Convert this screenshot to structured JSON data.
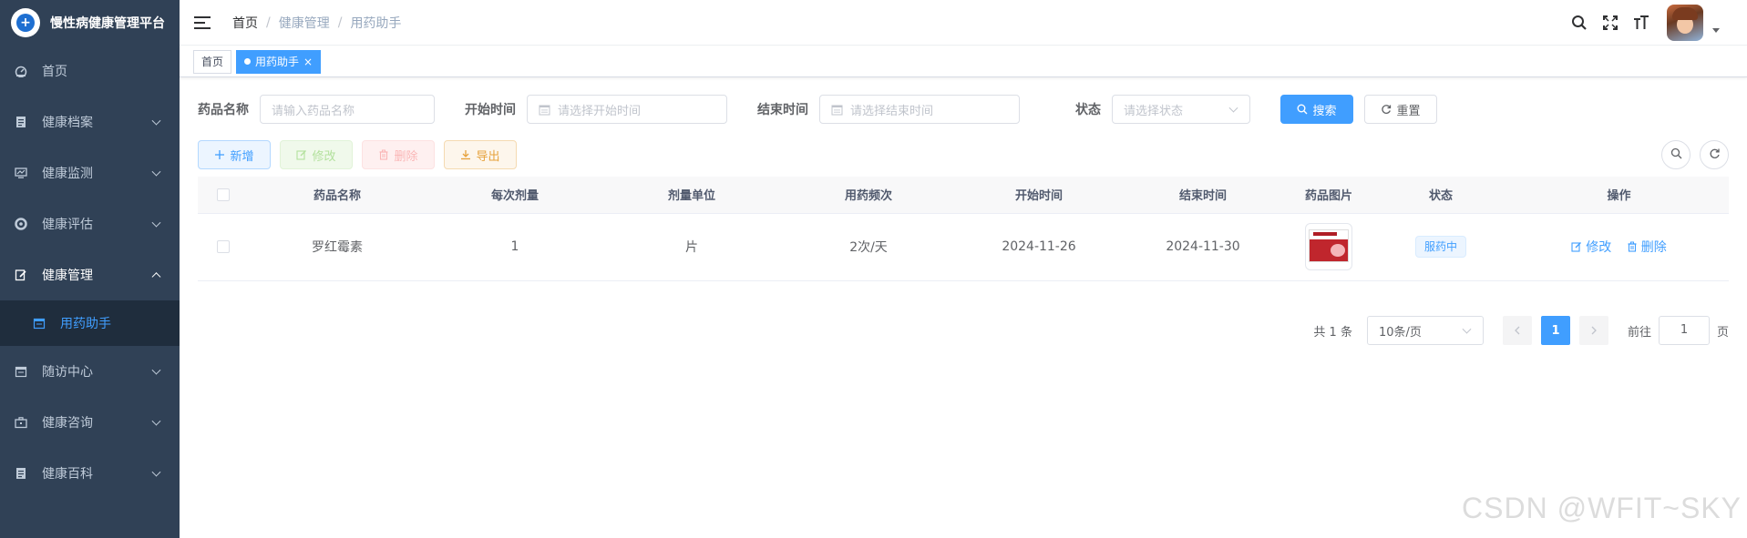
{
  "app": {
    "title": "慢性病健康管理平台"
  },
  "sidebar": {
    "items": [
      {
        "label": "首页",
        "icon": "dashboard-icon",
        "has_arrow": false
      },
      {
        "label": "健康档案",
        "icon": "document-icon",
        "has_arrow": true
      },
      {
        "label": "健康监测",
        "icon": "monitor-icon",
        "has_arrow": true
      },
      {
        "label": "健康评估",
        "icon": "assessment-icon",
        "has_arrow": true
      },
      {
        "label": "健康管理",
        "icon": "edit-icon",
        "has_arrow": true,
        "open": true
      },
      {
        "label": "随访中心",
        "icon": "calendar-icon",
        "has_arrow": true
      },
      {
        "label": "健康咨询",
        "icon": "briefcase-icon",
        "has_arrow": true
      },
      {
        "label": "健康百科",
        "icon": "book-icon",
        "has_arrow": true
      }
    ],
    "submenu": {
      "label": "用药助手",
      "icon": "calendar-icon"
    }
  },
  "navbar": {
    "breadcrumb": [
      "首页",
      "健康管理",
      "用药助手"
    ]
  },
  "tags": [
    {
      "label": "首页",
      "active": false
    },
    {
      "label": "用药助手",
      "active": true
    }
  ],
  "search": {
    "drug_name_label": "药品名称",
    "drug_name_placeholder": "请输入药品名称",
    "start_label": "开始时间",
    "start_placeholder": "请选择开始时间",
    "end_label": "结束时间",
    "end_placeholder": "请选择结束时间",
    "status_label": "状态",
    "status_placeholder": "请选择状态",
    "search_btn": "搜索",
    "reset_btn": "重置"
  },
  "toolbar": {
    "add": "新增",
    "edit": "修改",
    "delete": "删除",
    "export": "导出"
  },
  "table": {
    "headers": [
      "药品名称",
      "每次剂量",
      "剂量单位",
      "用药频次",
      "开始时间",
      "结束时间",
      "药品图片",
      "状态",
      "操作"
    ],
    "rows": [
      {
        "name": "罗红霉素",
        "dose": "1",
        "unit": "片",
        "frequency": "2次/天",
        "start": "2024-11-26",
        "end": "2024-11-30",
        "status": "服药中",
        "op_edit": "修改",
        "op_delete": "删除"
      }
    ]
  },
  "pagination": {
    "total": "共 1 条",
    "page_size": "10条/页",
    "current": "1",
    "goto_prefix": "前往",
    "goto_value": "1",
    "goto_suffix": "页"
  },
  "watermark": "CSDN @WFIT~SKY",
  "colors": {
    "sidebar_bg": "#304156",
    "primary": "#409eff"
  }
}
